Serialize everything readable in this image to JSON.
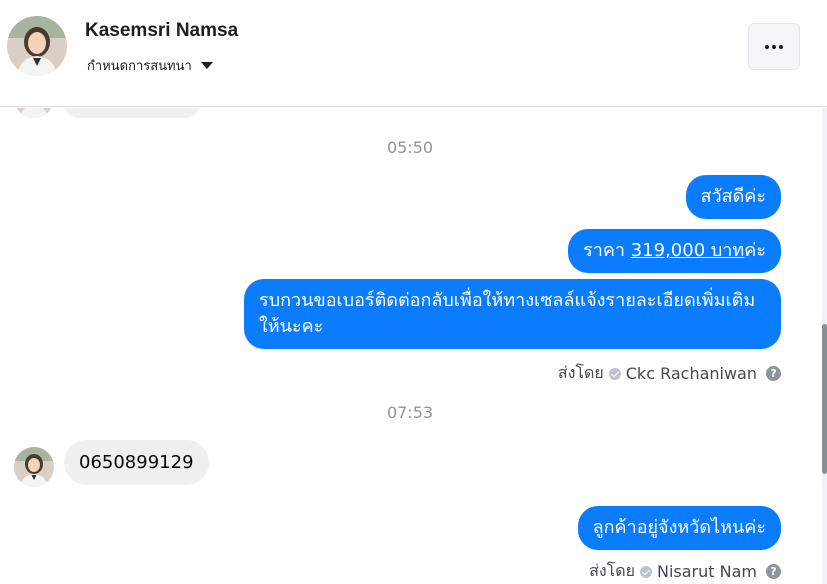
{
  "header": {
    "contact_name": "Kasemsri Namsa",
    "settings_label": "กำหนดการสนทนา",
    "more_icon": "more-dots-icon"
  },
  "timestamps": [
    "05:50",
    "07:53"
  ],
  "messages_group1": {
    "m1": "สวัสดีค่ะ",
    "m2_prefix": "ราคา ",
    "m2_link": "319,000 บาท",
    "m2_suffix": "ค่ะ",
    "m3": "รบกวนขอเบอร์ติดต่อกลับเพื่อให้ทางเซลล์แจ้งรายละเอียดเพิ่มเติมให้นะคะ",
    "sent_by_label": "ส่งโดย",
    "sent_by_name": "Ckc Rachaniwan"
  },
  "incoming": {
    "phone": "0650899129"
  },
  "messages_group2": {
    "m1": "ลูกค้าอยู่จังหวัดไหนค่ะ",
    "sent_by_label": "ส่งโดย",
    "sent_by_name": "Nisarut Nam"
  },
  "colors": {
    "outgoing_bubble": "#0a7cff",
    "incoming_bubble": "#f0f0f0"
  }
}
